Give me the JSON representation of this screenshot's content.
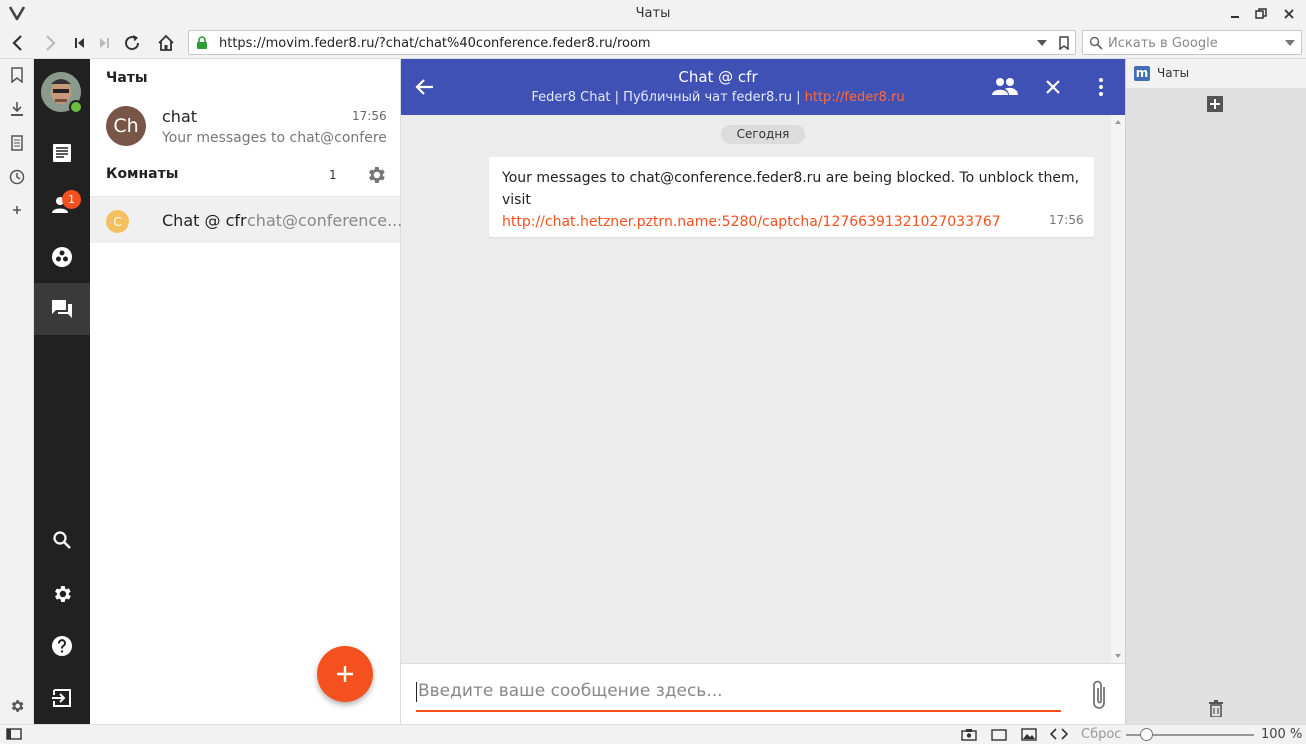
{
  "window": {
    "title": "Чаты"
  },
  "navbar": {
    "url": "https://movim.feder8.ru/?chat/chat%40conference.feder8.ru/room",
    "search_placeholder": "Искать в Google"
  },
  "app_nav": {
    "contacts_badge": "1"
  },
  "chats_panel": {
    "chats_heading": "Чаты",
    "chat_item": {
      "avatar_initials": "Ch",
      "name": "chat",
      "time": "17:56",
      "preview": "Your messages to chat@confere..."
    },
    "rooms_heading": "Комнаты",
    "rooms_count": "1",
    "room_item": {
      "avatar_initial": "C",
      "name": "Chat @ cfr",
      "jid": "chat@conference..."
    },
    "fab_label": "+"
  },
  "chat": {
    "title": "Chat @ cfr",
    "subtitle_prefix": "Feder8 Chat | Публичный чат feder8.ru |",
    "subtitle_link": "http://feder8.ru",
    "date_chip": "Сегодня",
    "message": {
      "text": "Your messages to chat@conference.feder8.ru are being blocked. To unblock them, visit",
      "link": "http://chat.hetzner.pztrn.name:5280/captcha/12766391321027033767",
      "time": "17:56"
    },
    "composer_placeholder": "Введите ваше сообщение здесь..."
  },
  "right_panel": {
    "tab_title": "Чаты"
  },
  "statusbar": {
    "reset_label": "Сброс",
    "zoom": "100 %",
    "zoom_level": 100
  },
  "colors": {
    "header": "#3f51b5",
    "accent": "#f4511e",
    "dark_nav": "#212121"
  }
}
